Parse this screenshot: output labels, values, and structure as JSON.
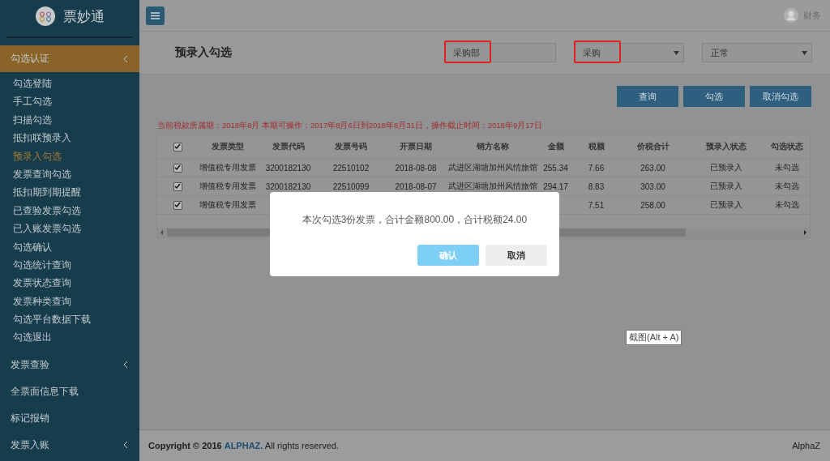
{
  "sidebar": {
    "logo_text": "票妙通",
    "groups": [
      {
        "label": "勾选认证",
        "expanded": true,
        "selected": true,
        "has_children": true,
        "items": [
          {
            "label": "勾选登陆",
            "selected": false
          },
          {
            "label": "手工勾选",
            "selected": false
          },
          {
            "label": "扫描勾选",
            "selected": false
          },
          {
            "label": "抵扣联预录入",
            "selected": false
          },
          {
            "label": "预录入勾选",
            "selected": true
          },
          {
            "label": "发票查询勾选",
            "selected": false
          },
          {
            "label": "抵扣期到期提醒",
            "selected": false
          },
          {
            "label": "已查验发票勾选",
            "selected": false
          },
          {
            "label": "已入账发票勾选",
            "selected": false
          },
          {
            "label": "勾选确认",
            "selected": false
          },
          {
            "label": "勾选统计查询",
            "selected": false
          },
          {
            "label": "发票状态查询",
            "selected": false
          },
          {
            "label": "发票种类查询",
            "selected": false
          },
          {
            "label": "勾选平台数据下载",
            "selected": false
          },
          {
            "label": "勾选退出",
            "selected": false
          }
        ]
      },
      {
        "label": "发票查验",
        "expanded": false,
        "selected": false,
        "has_children": true
      },
      {
        "label": "全票面信息下载",
        "selected": false,
        "has_children": false
      },
      {
        "label": "标记报销",
        "selected": false,
        "has_children": false
      },
      {
        "label": "发票入账",
        "expanded": false,
        "selected": false,
        "has_children": true
      }
    ]
  },
  "header": {
    "user": "财务"
  },
  "page_title": "预录入勾选",
  "filters": [
    {
      "kind": "input",
      "value": "采购部",
      "highlighted": true
    },
    {
      "kind": "select",
      "value": "采购",
      "highlighted": true
    },
    {
      "kind": "select",
      "value": "正常",
      "highlighted": false
    }
  ],
  "buttons": [
    "查询",
    "勾选",
    "取消勾选"
  ],
  "notice": "当前税款所属期：2018年8月 本期可操作：2017年8月6日到2018年8月31日，操作截止时间：2018年9月17日",
  "table": {
    "header_checked": true,
    "columns": [
      "发票类型",
      "发票代码",
      "发票号码",
      "开票日期",
      "销方名称",
      "金额",
      "税额",
      "价税合计",
      "预录入状态",
      "勾选状态"
    ],
    "rows": [
      {
        "checked": true,
        "type": "增值税专用发票",
        "code": "3200182130",
        "number": "22510102",
        "date": "2018-08-08",
        "seller": "武进区湖塘加州风情旅馆",
        "amount": "255.34",
        "tax": "7.66",
        "total": "263.00",
        "entry_status": "已预录入",
        "check_status": "未勾选"
      },
      {
        "checked": true,
        "type": "增值税专用发票",
        "code": "3200182130",
        "number": "22510099",
        "date": "2018-08-07",
        "seller": "武进区湖塘加州风情旅馆",
        "amount": "294.17",
        "tax": "8.83",
        "total": "303.00",
        "entry_status": "已预录入",
        "check_status": "未勾选"
      },
      {
        "checked": true,
        "type": "增值税专用发票",
        "tax": "7.51",
        "total": "258.00",
        "entry_status": "已预录入",
        "check_status": "未勾选"
      }
    ]
  },
  "dialog": {
    "message": "本次勾选3份发票，合计金额800.00，合计税额24.00",
    "confirm": "确认",
    "cancel": "取消"
  },
  "tooltip": "截图(Alt + A)",
  "footer": {
    "copyright_prefix": "Copyright © 2016",
    "brand": "ALPHAZ.",
    "copyright_suffix": "All rights reserved.",
    "right": "AlphaZ"
  }
}
